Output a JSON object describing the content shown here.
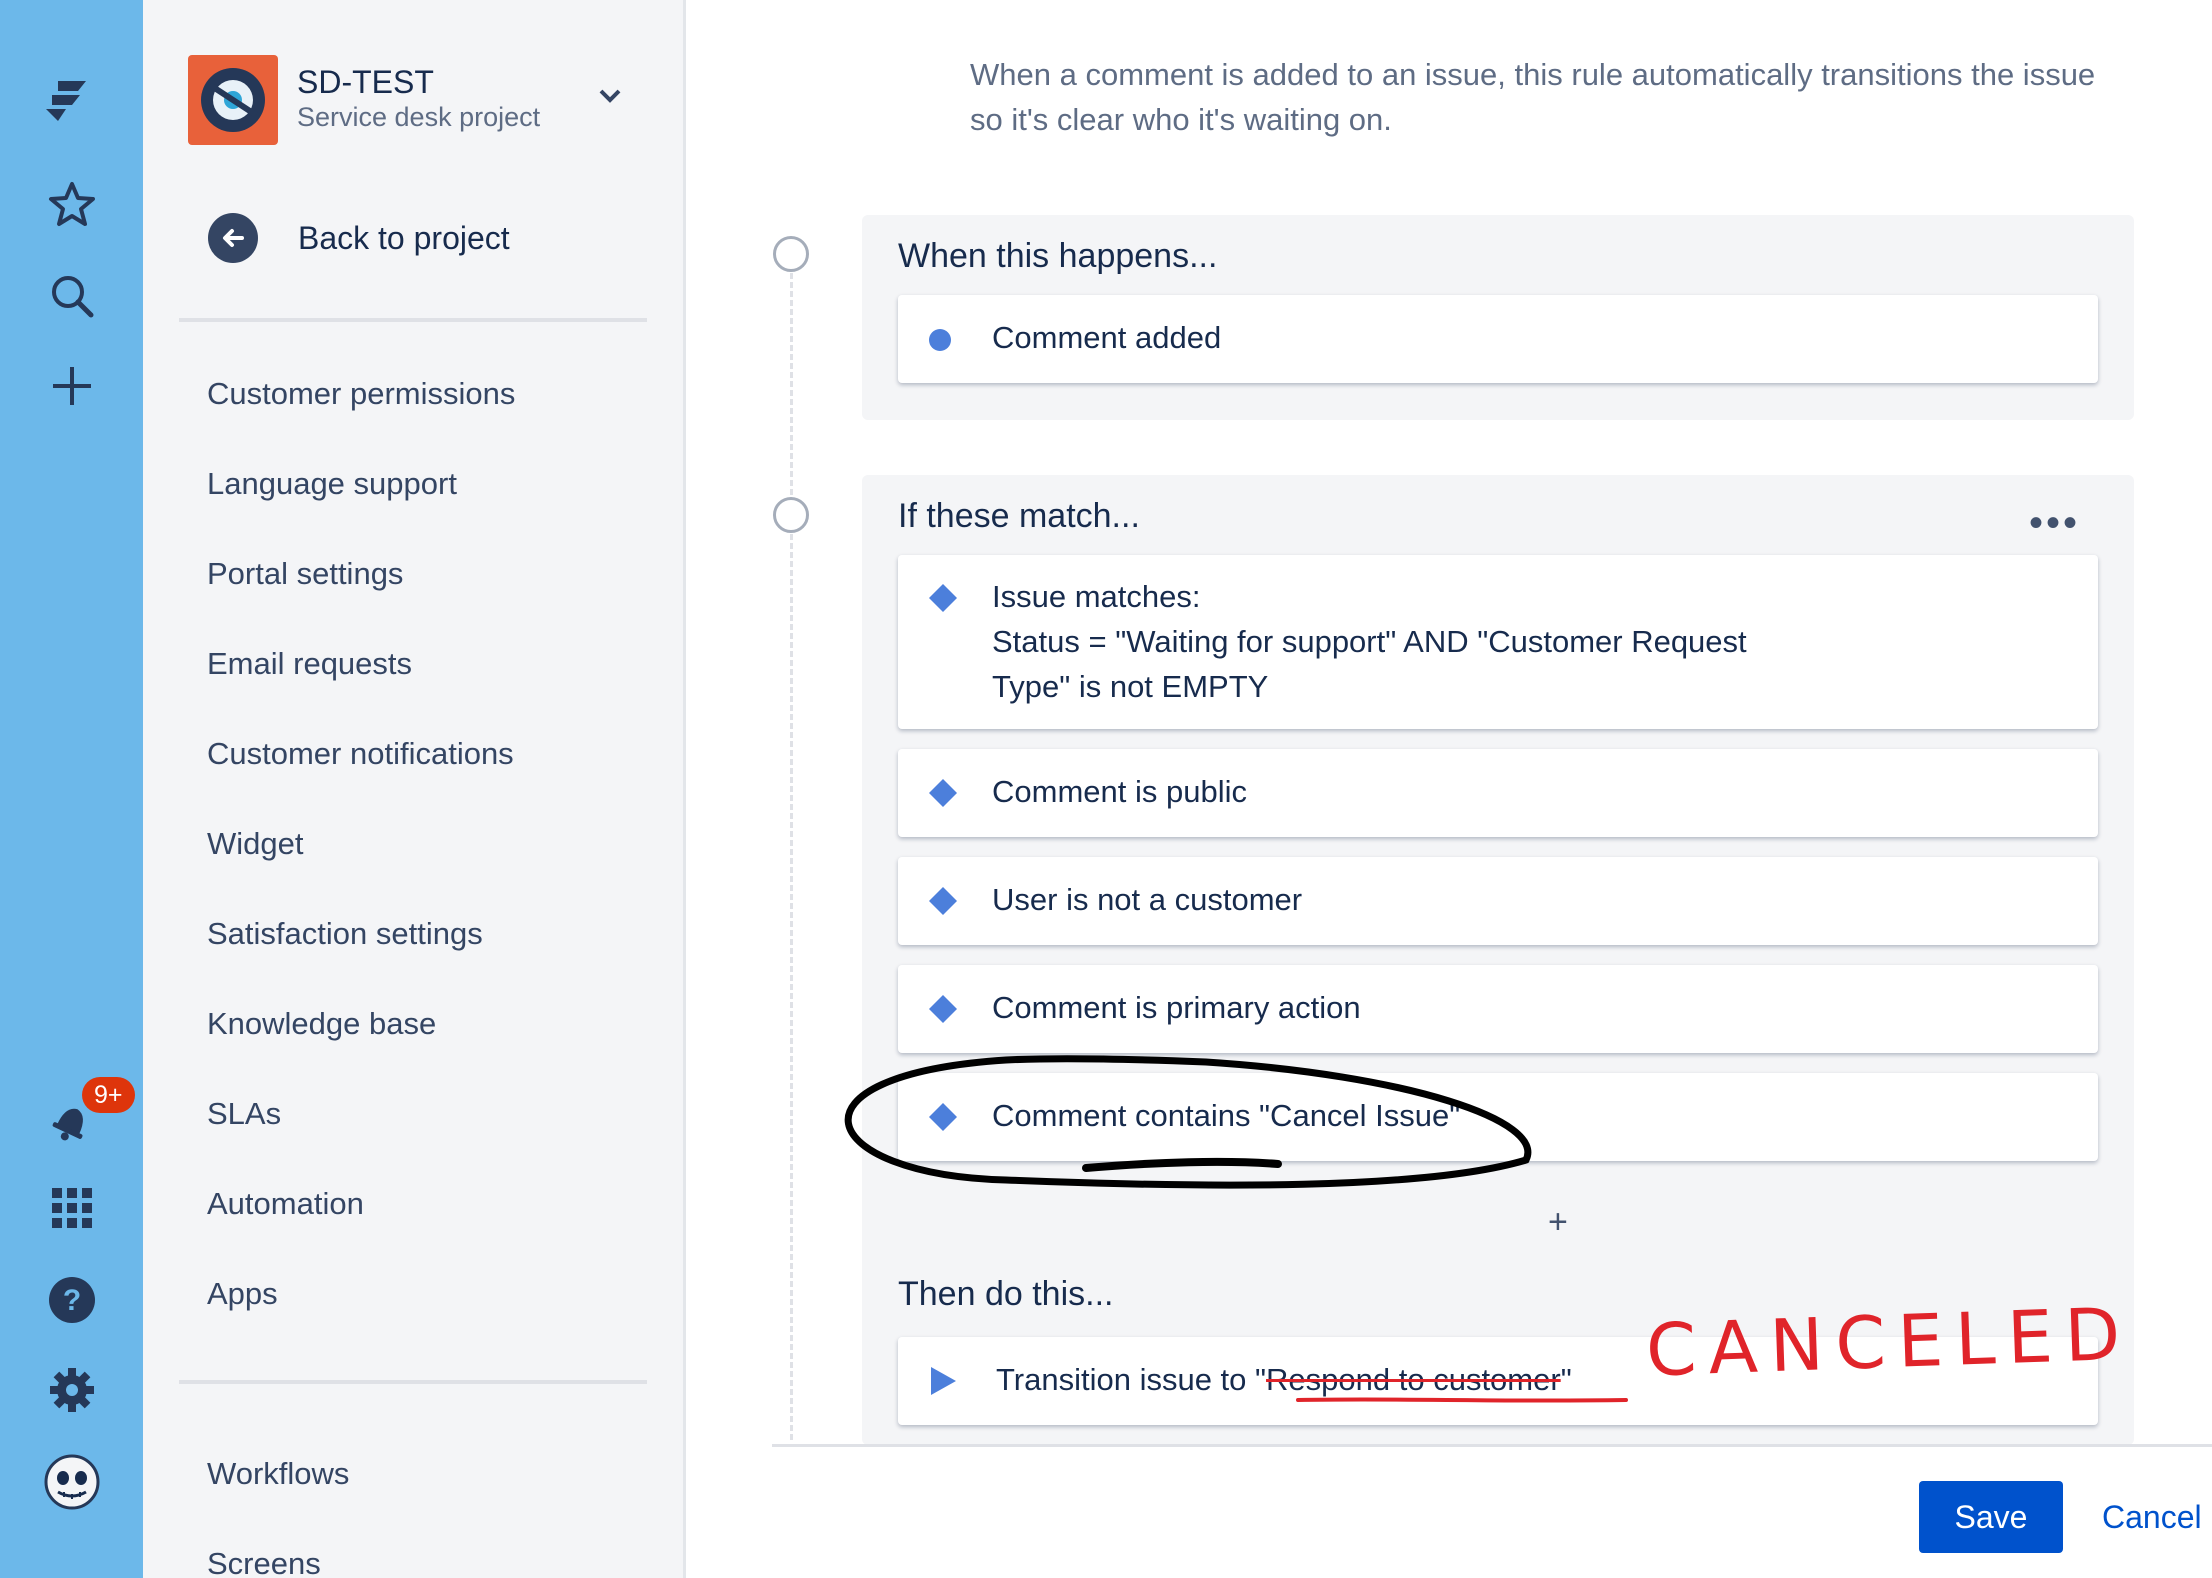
{
  "project": {
    "name": "SD-TEST",
    "type": "Service desk project"
  },
  "sidebar": {
    "back_label": "Back to project",
    "items": [
      {
        "label": "Customer permissions"
      },
      {
        "label": "Language support"
      },
      {
        "label": "Portal settings"
      },
      {
        "label": "Email requests"
      },
      {
        "label": "Customer notifications"
      },
      {
        "label": "Widget"
      },
      {
        "label": "Satisfaction settings"
      },
      {
        "label": "Knowledge base"
      },
      {
        "label": "SLAs"
      },
      {
        "label": "Automation"
      },
      {
        "label": "Apps"
      },
      {
        "label": "Workflows"
      },
      {
        "label": "Screens"
      }
    ]
  },
  "global_nav": {
    "notifications_badge": "9+",
    "icons": [
      "jira-logo-icon",
      "star-icon",
      "search-icon",
      "create-icon",
      "notifications-icon",
      "app-switcher-icon",
      "help-icon",
      "settings-icon",
      "profile-avatar-icon"
    ]
  },
  "rule": {
    "description": "When a comment is added to an issue, this rule automatically transitions the issue so it's clear who it's waiting on.",
    "when": {
      "title": "When this happens...",
      "trigger": "Comment added"
    },
    "if": {
      "title": "If these match...",
      "more": "•••",
      "conditions": [
        {
          "lines": [
            "Issue matches:",
            "Status = \"Waiting for support\" AND \"Customer Request",
            "Type\" is not EMPTY"
          ]
        },
        {
          "lines": [
            "Comment is public"
          ]
        },
        {
          "lines": [
            "User is not a customer"
          ]
        },
        {
          "lines": [
            "Comment is primary action"
          ]
        },
        {
          "lines": [
            "Comment contains \"Cancel Issue\""
          ]
        }
      ],
      "add": "+"
    },
    "then": {
      "title": "Then do this...",
      "action_prefix": "Transition issue to \"",
      "action_struck": "Respond to customer",
      "action_suffix": "\""
    }
  },
  "annotation": {
    "handwritten": "CANCELED",
    "color": "#E0242A"
  },
  "footer": {
    "save": "Save",
    "cancel": "Cancel"
  },
  "colors": {
    "nav": "#6CB8EA",
    "accent": "#0052CC",
    "icon_blue": "#4C7FDB"
  }
}
